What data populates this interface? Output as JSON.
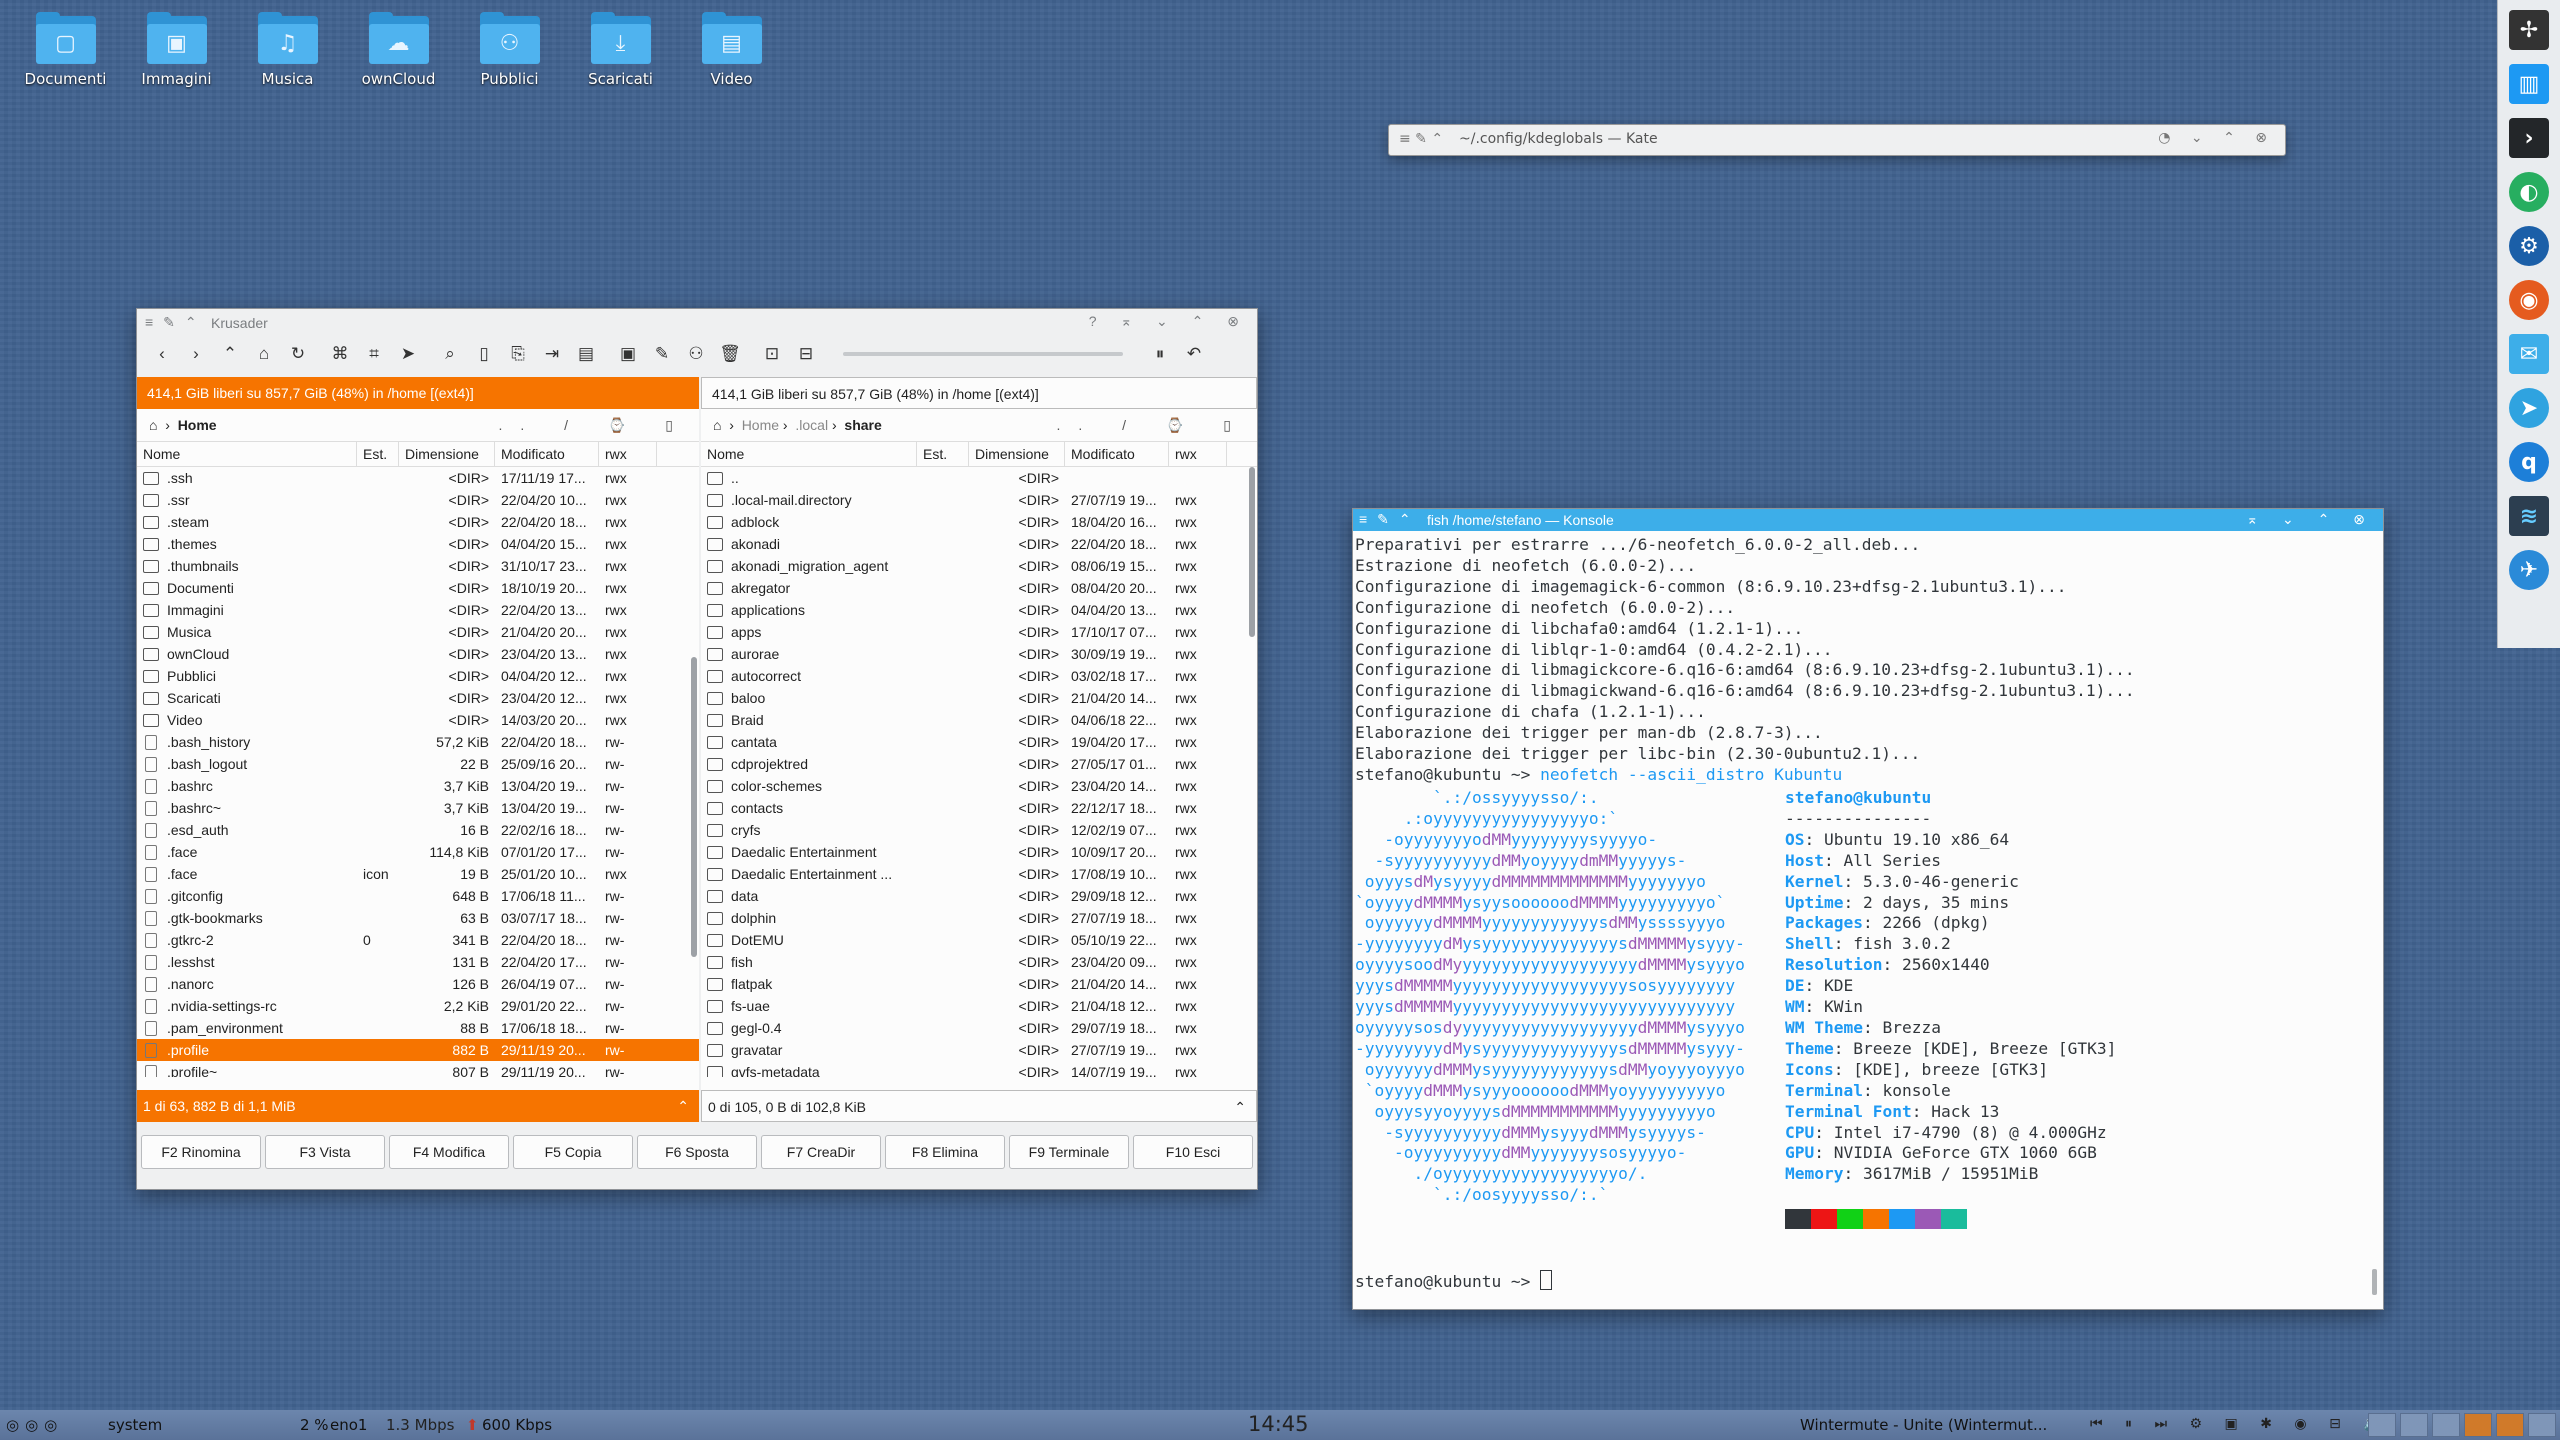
{
  "desktop_icons": [
    {
      "label": "Documenti",
      "glyph": "▢"
    },
    {
      "label": "Immagini",
      "glyph": "▣"
    },
    {
      "label": "Musica",
      "glyph": "♫"
    },
    {
      "label": "ownCloud",
      "glyph": "☁"
    },
    {
      "label": "Pubblici",
      "glyph": "⚇"
    },
    {
      "label": "Scaricati",
      "glyph": "⤓"
    },
    {
      "label": "Video",
      "glyph": "▤"
    }
  ],
  "kate": {
    "title": "~/.config/kdeglobals — Kate"
  },
  "krusader": {
    "title": "Krusader",
    "left": {
      "free": "414,1 GiB liberi su 857,7 GiB (48%) in /home [(ext4)]",
      "path": "Home",
      "columns": [
        "Nome",
        "Est.",
        "Dimensione",
        "Modificato",
        "rwx"
      ],
      "rows": [
        [
          ".ssh",
          "",
          "<DIR>",
          "17/11/19 17...",
          "rwx"
        ],
        [
          ".ssr",
          "",
          "<DIR>",
          "22/04/20 10...",
          "rwx"
        ],
        [
          ".steam",
          "",
          "<DIR>",
          "22/04/20 18...",
          "rwx"
        ],
        [
          ".themes",
          "",
          "<DIR>",
          "04/04/20 15...",
          "rwx"
        ],
        [
          ".thumbnails",
          "",
          "<DIR>",
          "31/10/17 23...",
          "rwx"
        ],
        [
          "Documenti",
          "",
          "<DIR>",
          "18/10/19 20...",
          "rwx"
        ],
        [
          "Immagini",
          "",
          "<DIR>",
          "22/04/20 13...",
          "rwx"
        ],
        [
          "Musica",
          "",
          "<DIR>",
          "21/04/20 20...",
          "rwx"
        ],
        [
          "ownCloud",
          "",
          "<DIR>",
          "23/04/20 13...",
          "rwx"
        ],
        [
          "Pubblici",
          "",
          "<DIR>",
          "04/04/20 12...",
          "rwx"
        ],
        [
          "Scaricati",
          "",
          "<DIR>",
          "23/04/20 12...",
          "rwx"
        ],
        [
          "Video",
          "",
          "<DIR>",
          "14/03/20 20...",
          "rwx"
        ],
        [
          ".bash_history",
          "",
          "57,2 KiB",
          "22/04/20 18...",
          "rw-"
        ],
        [
          ".bash_logout",
          "",
          "22 B",
          "25/09/16 20...",
          "rw-"
        ],
        [
          ".bashrc",
          "",
          "3,7 KiB",
          "13/04/20 19...",
          "rw-"
        ],
        [
          ".bashrc~",
          "",
          "3,7 KiB",
          "13/04/20 19...",
          "rw-"
        ],
        [
          ".esd_auth",
          "",
          "16 B",
          "22/02/16 18...",
          "rw-"
        ],
        [
          ".face",
          "",
          "114,8 KiB",
          "07/01/20 17...",
          "rw-"
        ],
        [
          ".face",
          "icon",
          "19 B",
          "25/01/20 10...",
          "rwx"
        ],
        [
          ".gitconfig",
          "",
          "648 B",
          "17/06/18 11...",
          "rw-"
        ],
        [
          ".gtk-bookmarks",
          "",
          "63 B",
          "03/07/17 18...",
          "rw-"
        ],
        [
          ".gtkrc-2",
          "0",
          "341 B",
          "22/04/20 18...",
          "rw-"
        ],
        [
          ".lesshst",
          "",
          "131 B",
          "22/04/20 17...",
          "rw-"
        ],
        [
          ".nanorc",
          "",
          "126 B",
          "26/04/19 07...",
          "rw-"
        ],
        [
          ".nvidia-settings-rc",
          "",
          "2,2 KiB",
          "29/01/20 22...",
          "rw-"
        ],
        [
          ".pam_environment",
          "",
          "88 B",
          "17/06/18 18...",
          "rw-"
        ],
        [
          ".profile",
          "",
          "882 B",
          "29/11/19 20...",
          "rw-"
        ],
        [
          ".profile~",
          "",
          "807 B",
          "29/11/19 20...",
          "rw-"
        ]
      ],
      "selected_index": 26,
      "footer": "1 di 63, 882 B di 1,1 MiB"
    },
    "right": {
      "free": "414,1 GiB liberi su 857,7 GiB (48%) in /home [(ext4)]",
      "path": [
        "Home",
        ".local",
        "share"
      ],
      "columns": [
        "Nome",
        "Est.",
        "Dimensione",
        "Modificato",
        "rwx"
      ],
      "rows": [
        [
          "..",
          "",
          "<DIR>",
          "",
          ""
        ],
        [
          ".local-mail.directory",
          "",
          "<DIR>",
          "27/07/19 19...",
          "rwx"
        ],
        [
          "adblock",
          "",
          "<DIR>",
          "18/04/20 16...",
          "rwx"
        ],
        [
          "akonadi",
          "",
          "<DIR>",
          "22/04/20 18...",
          "rwx"
        ],
        [
          "akonadi_migration_agent",
          "",
          "<DIR>",
          "08/06/19 15...",
          "rwx"
        ],
        [
          "akregator",
          "",
          "<DIR>",
          "08/04/20 20...",
          "rwx"
        ],
        [
          "applications",
          "",
          "<DIR>",
          "04/04/20 13...",
          "rwx"
        ],
        [
          "apps",
          "",
          "<DIR>",
          "17/10/17 07...",
          "rwx"
        ],
        [
          "aurorae",
          "",
          "<DIR>",
          "30/09/19 19...",
          "rwx"
        ],
        [
          "autocorrect",
          "",
          "<DIR>",
          "03/02/18 17...",
          "rwx"
        ],
        [
          "baloo",
          "",
          "<DIR>",
          "21/04/20 14...",
          "rwx"
        ],
        [
          "Braid",
          "",
          "<DIR>",
          "04/06/18 22...",
          "rwx"
        ],
        [
          "cantata",
          "",
          "<DIR>",
          "19/04/20 17...",
          "rwx"
        ],
        [
          "cdprojektred",
          "",
          "<DIR>",
          "27/05/17 01...",
          "rwx"
        ],
        [
          "color-schemes",
          "",
          "<DIR>",
          "23/04/20 14...",
          "rwx"
        ],
        [
          "contacts",
          "",
          "<DIR>",
          "22/12/17 18...",
          "rwx"
        ],
        [
          "cryfs",
          "",
          "<DIR>",
          "12/02/19 07...",
          "rwx"
        ],
        [
          "Daedalic Entertainment",
          "",
          "<DIR>",
          "10/09/17 20...",
          "rwx"
        ],
        [
          "Daedalic Entertainment ...",
          "",
          "<DIR>",
          "17/08/19 10...",
          "rwx"
        ],
        [
          "data",
          "",
          "<DIR>",
          "29/09/18 12...",
          "rwx"
        ],
        [
          "dolphin",
          "",
          "<DIR>",
          "27/07/19 18...",
          "rwx"
        ],
        [
          "DotEMU",
          "",
          "<DIR>",
          "05/10/19 22...",
          "rwx"
        ],
        [
          "fish",
          "",
          "<DIR>",
          "23/04/20 09...",
          "rwx"
        ],
        [
          "flatpak",
          "",
          "<DIR>",
          "21/04/20 14...",
          "rwx"
        ],
        [
          "fs-uae",
          "",
          "<DIR>",
          "21/04/18 12...",
          "rwx"
        ],
        [
          "gegl-0.4",
          "",
          "<DIR>",
          "29/07/19 18...",
          "rwx"
        ],
        [
          "gravatar",
          "",
          "<DIR>",
          "27/07/19 19...",
          "rwx"
        ],
        [
          "gvfs-metadata",
          "",
          "<DIR>",
          "14/07/19 19...",
          "rwx"
        ]
      ],
      "footer": "0 di 105, 0 B di 102,8 KiB"
    },
    "fkeys": [
      "F2 Rinomina",
      "F3 Vista",
      "F4 Modifica",
      "F5 Copia",
      "F6 Sposta",
      "F7 CreaDir",
      "F8 Elimina",
      "F9 Terminale",
      "F10 Esci"
    ]
  },
  "konsole": {
    "title": "fish /home/stefano — Konsole",
    "log": [
      "Preparativi per estrarre .../6-neofetch_6.0.0-2_all.deb...",
      "Estrazione di neofetch (6.0.0-2)...",
      "Configurazione di imagemagick-6-common (8:6.9.10.23+dfsg-2.1ubuntu3.1)...",
      "Configurazione di neofetch (6.0.0-2)...",
      "Configurazione di libchafa0:amd64 (1.2.1-1)...",
      "Configurazione di liblqr-1-0:amd64 (0.4.2-2.1)...",
      "Configurazione di libmagickcore-6.q16-6:amd64 (8:6.9.10.23+dfsg-2.1ubuntu3.1)...",
      "Configurazione di libmagickwand-6.q16-6:amd64 (8:6.9.10.23+dfsg-2.1ubuntu3.1)...",
      "Configurazione di chafa (1.2.1-1)...",
      "Elaborazione dei trigger per man-db (2.8.7-3)...",
      "Elaborazione dei trigger per libc-bin (2.30-0ubuntu2.1)..."
    ],
    "cmd_prompt": "stefano@kubuntu ~> ",
    "cmd": "neofetch --ascii_distro Kubuntu",
    "user": "stefano@kubuntu",
    "sep": "---------------",
    "info": [
      [
        "OS",
        "Ubuntu 19.10 x86_64"
      ],
      [
        "Host",
        "All Series"
      ],
      [
        "Kernel",
        "5.3.0-46-generic"
      ],
      [
        "Uptime",
        "2 days, 35 mins"
      ],
      [
        "Packages",
        "2266 (dpkg)"
      ],
      [
        "Shell",
        "fish 3.0.2"
      ],
      [
        "Resolution",
        "2560x1440"
      ],
      [
        "DE",
        "KDE"
      ],
      [
        "WM",
        "KWin"
      ],
      [
        "WM Theme",
        "Brezza"
      ],
      [
        "Theme",
        "Breeze [KDE], Breeze [GTK3]"
      ],
      [
        "Icons",
        "[KDE], breeze [GTK3]"
      ],
      [
        "Terminal",
        "konsole"
      ],
      [
        "Terminal Font",
        "Hack 13"
      ],
      [
        "CPU",
        "Intel i7-4790 (8) @ 4.000GHz"
      ],
      [
        "GPU",
        "NVIDIA GeForce GTX 1060 6GB"
      ],
      [
        "Memory",
        "3617MiB / 15951MiB"
      ]
    ],
    "palette": [
      "#31363b",
      "#ed1515",
      "#11d116",
      "#f67400",
      "#1d99f3",
      "#9b59b6",
      "#1abc9c"
    ],
    "final_prompt": "stefano@kubuntu ~> "
  },
  "panel": {
    "system": "system",
    "cpu": "2 %",
    "net": "eno1",
    "down": "1.3 Mbps",
    "up": "600 Kbps",
    "clock": "14:45",
    "media": "Wintermute - Unite (Wintermut..."
  }
}
